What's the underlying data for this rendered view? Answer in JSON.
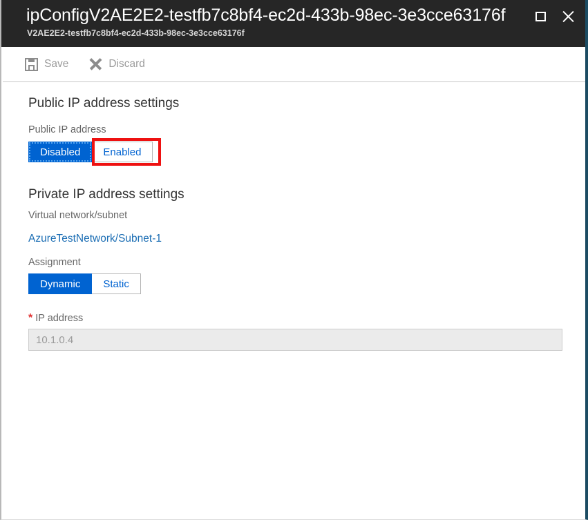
{
  "window": {
    "title": "ipConfigV2AE2E2-testfb7c8bf4-ec2d-433b-98ec-3e3cce63176f",
    "subtitle": "V2AE2E2-testfb7c8bf4-ec2d-433b-98ec-3e3cce63176f",
    "restore_icon": "restore-window-icon",
    "close_icon": "close-window-icon"
  },
  "toolbar": {
    "save_label": "Save",
    "save_icon": "floppy-disk-icon",
    "discard_label": "Discard",
    "discard_icon": "x-cross-icon",
    "disabled": true
  },
  "public_ip": {
    "heading": "Public IP address settings",
    "field_label": "Public IP address",
    "options": [
      "Disabled",
      "Enabled"
    ],
    "selected": "Disabled",
    "highlighted_option": "Enabled"
  },
  "private_ip": {
    "heading": "Private IP address settings",
    "vnet_label": "Virtual network/subnet",
    "vnet_value": "AzureTestNetwork/Subnet-1",
    "assignment_label": "Assignment",
    "assignment_options": [
      "Dynamic",
      "Static"
    ],
    "assignment_selected": "Dynamic",
    "ip_label": "IP address",
    "ip_required_marker": "*",
    "ip_value": "10.1.0.4"
  },
  "colors": {
    "accent_blue": "#0063d1",
    "link_blue": "#1c6eb4",
    "titlebar_bg": "#262626",
    "annotation_red": "#ee1111",
    "required_red": "#e03030",
    "disabled_text": "#9b9b9b"
  }
}
